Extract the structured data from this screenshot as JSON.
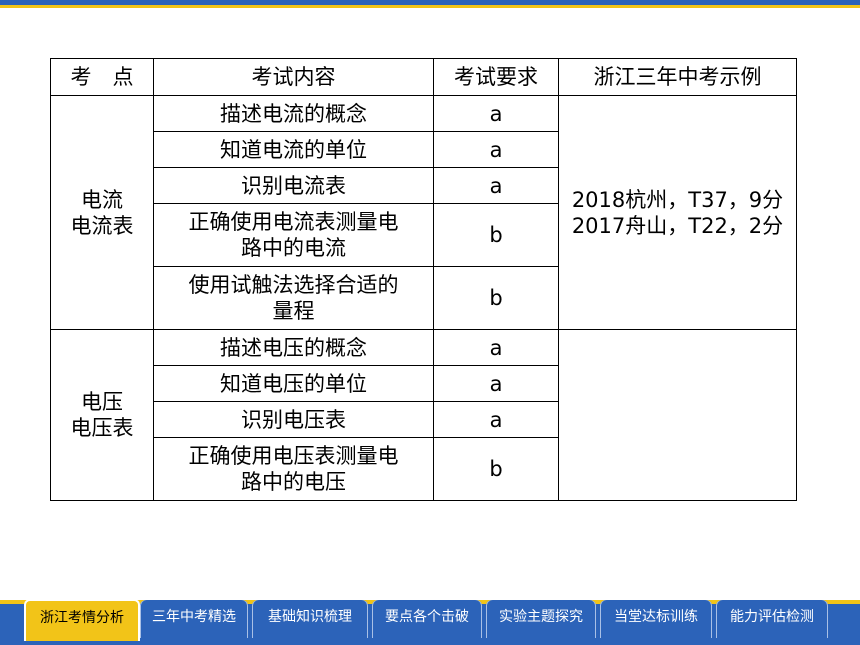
{
  "table": {
    "headers": [
      "考　点",
      "考试内容",
      "考试要求",
      "浙江三年中考示例"
    ],
    "group1": {
      "topic_line1": "电流",
      "topic_line2": "电流表",
      "rows": [
        {
          "content": "描述电流的概念",
          "level": "a"
        },
        {
          "content": "知道电流的单位",
          "level": "a"
        },
        {
          "content": "识别电流表",
          "level": "a"
        },
        {
          "content_line1": "正确使用电流表测量电",
          "content_line2": "路中的电流",
          "level": "b"
        },
        {
          "content_line1": "使用试触法选择合适的",
          "content_line2": "量程",
          "level": "b"
        }
      ],
      "example_line1": "2018杭州，T37，9分",
      "example_line2": "2017舟山，T22，2分"
    },
    "group2": {
      "topic_line1": "电压",
      "topic_line2": "电压表",
      "rows": [
        {
          "content": "描述电压的概念",
          "level": "a"
        },
        {
          "content": "知道电压的单位",
          "level": "a"
        },
        {
          "content": "识别电压表",
          "level": "a"
        },
        {
          "content_line1": "正确使用电压表测量电",
          "content_line2": "路中的电压",
          "level": "b"
        }
      ],
      "example": ""
    }
  },
  "nav": {
    "active_index": 0,
    "tabs": [
      "浙江考情分析",
      "三年中考精选",
      "基础知识梳理",
      "要点各个击破",
      "实验主题探究",
      "当堂达标训练",
      "能力评估检测"
    ]
  },
  "colors": {
    "bar_blue": "#2c63b9",
    "accent_yellow": "#f2c418"
  }
}
